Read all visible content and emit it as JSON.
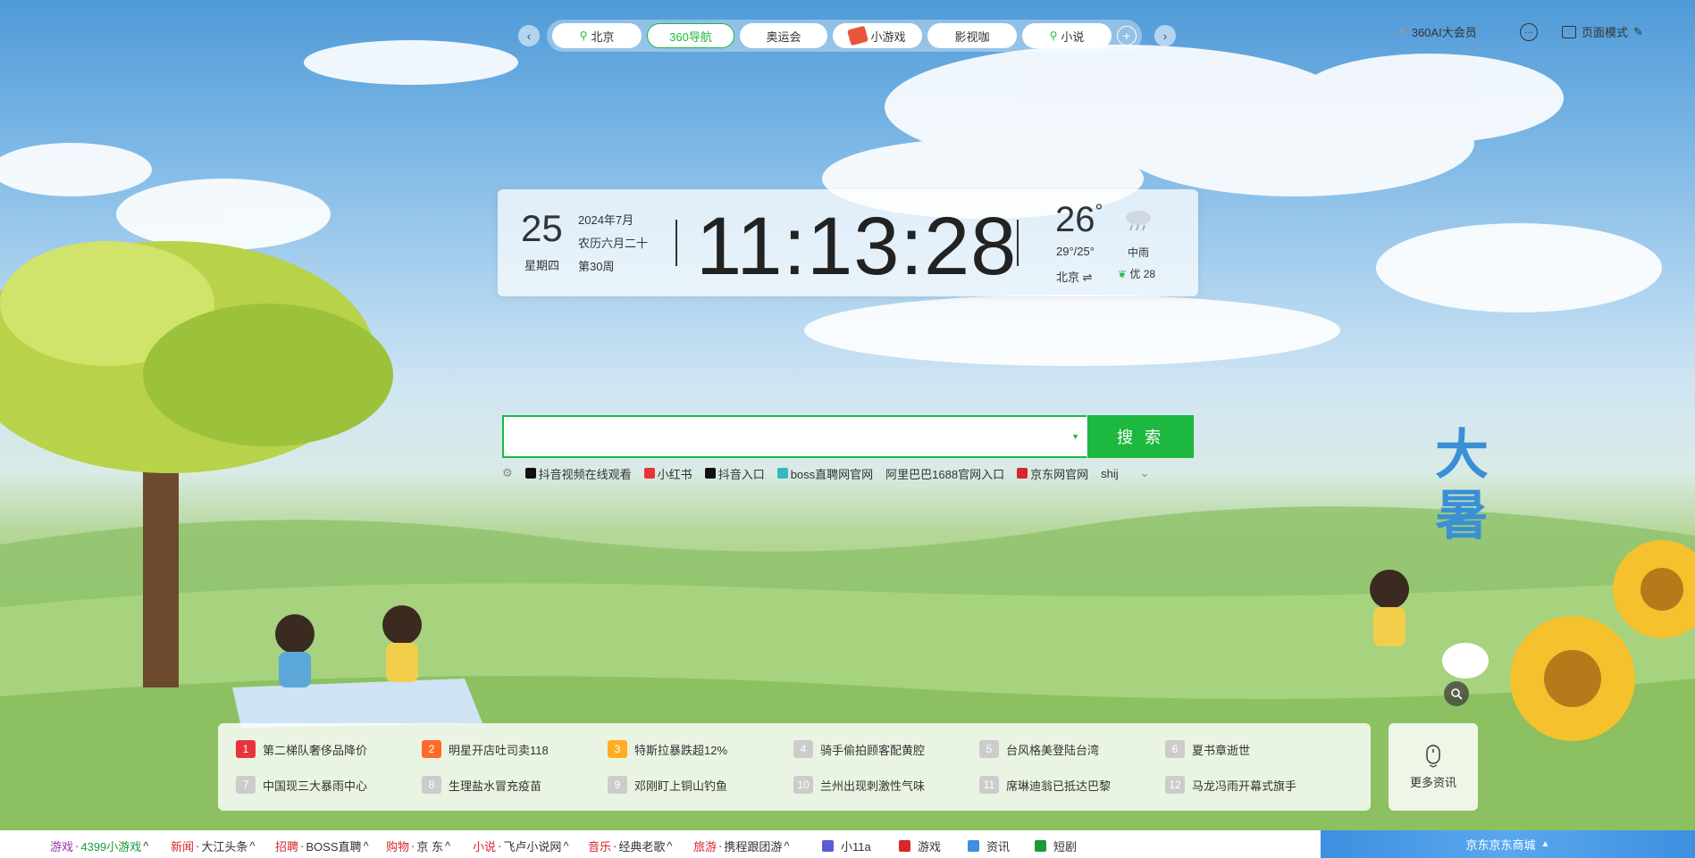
{
  "topnav": {
    "tabs": [
      {
        "label": "北京",
        "icon": "location-pin-icon"
      },
      {
        "label": "360导航",
        "icon": ""
      },
      {
        "label": "奥运会",
        "icon": ""
      },
      {
        "label": "小游戏",
        "icon": "game-icon"
      },
      {
        "label": "影视咖",
        "icon": ""
      },
      {
        "label": "小说",
        "icon": "location-pin-icon"
      }
    ],
    "active_index": 1
  },
  "top_right": {
    "vip_label": "360AI大会员",
    "page_mode_label": "页面模式"
  },
  "clock": {
    "day": "25",
    "weekday": "星期四",
    "year_month": "2024年7月",
    "lunar": "农历六月二十",
    "week": "第30周",
    "time": "11:13:28"
  },
  "weather": {
    "temp": "26",
    "temp_unit": "°",
    "range": "29°/25°",
    "city": "北京",
    "city_switch": "⇌",
    "desc": "中雨",
    "aqi": "优 28"
  },
  "search": {
    "value": "",
    "button_label": "搜 索",
    "hot_links": [
      {
        "label": "抖音视频在线观看",
        "icon_color": "#111111"
      },
      {
        "label": "小红书",
        "icon_color": "#e8333c"
      },
      {
        "label": "抖音入口",
        "icon_color": "#111111"
      },
      {
        "label": "boss直聘网官网",
        "icon_color": "#36b7c4"
      },
      {
        "label": "阿里巴巴1688官网入口",
        "icon_color": ""
      },
      {
        "label": "京东网官网",
        "icon_color": "#d8262c"
      },
      {
        "label": "shij",
        "icon_color": ""
      }
    ]
  },
  "news": {
    "items": [
      {
        "rank": "1",
        "title": "第二梯队奢侈品降价"
      },
      {
        "rank": "2",
        "title": "明星开店吐司卖118"
      },
      {
        "rank": "3",
        "title": "特斯拉暴跌超12%"
      },
      {
        "rank": "4",
        "title": "骑手偷拍顾客配黄腔"
      },
      {
        "rank": "5",
        "title": "台风格美登陆台湾"
      },
      {
        "rank": "6",
        "title": "夏书章逝世"
      },
      {
        "rank": "7",
        "title": "中国现三大暴雨中心"
      },
      {
        "rank": "8",
        "title": "生理盐水冒充疫苗"
      },
      {
        "rank": "9",
        "title": "邓刚盯上铜山钓鱼"
      },
      {
        "rank": "10",
        "title": "兰州出现刺激性气味"
      },
      {
        "rank": "11",
        "title": "席琳迪翁已抵达巴黎"
      },
      {
        "rank": "12",
        "title": "马龙冯雨开幕式旗手"
      }
    ],
    "more_label": "更多资讯"
  },
  "season_text": "大暑",
  "bottom_bar": {
    "categories": [
      {
        "cat": "游戏",
        "cat_color": "#9b2fae",
        "sep": "·",
        "site": "4399小游戏",
        "site_color": "#1d9a3a"
      },
      {
        "cat": "新闻",
        "cat_color": "#d8262c",
        "sep": "·",
        "site": "大江头条",
        "site_color": "#333333"
      },
      {
        "cat": "招聘",
        "cat_color": "#d8262c",
        "sep": "·",
        "site": "BOSS直聘",
        "site_color": "#333333"
      },
      {
        "cat": "购物",
        "cat_color": "#d8262c",
        "sep": "·",
        "site": "京 东",
        "site_color": "#333333"
      },
      {
        "cat": "小说",
        "cat_color": "#d8262c",
        "sep": "·",
        "site": "飞卢小说网",
        "site_color": "#333333"
      },
      {
        "cat": "音乐",
        "cat_color": "#d8262c",
        "sep": "·",
        "site": "经典老歌",
        "site_color": "#333333"
      },
      {
        "cat": "旅游",
        "cat_color": "#d8262c",
        "sep": "·",
        "site": "携程跟团游",
        "site_color": "#333333"
      }
    ],
    "shortcuts": [
      {
        "label": "小11a",
        "icon": "app-icon"
      },
      {
        "label": "游戏",
        "icon": "game-icon"
      },
      {
        "label": "资讯",
        "icon": "news-icon"
      },
      {
        "label": "短剧",
        "icon": "video-icon"
      }
    ],
    "promo_label": "京东京东商城"
  },
  "colors": {
    "accent": "#1db83f"
  }
}
